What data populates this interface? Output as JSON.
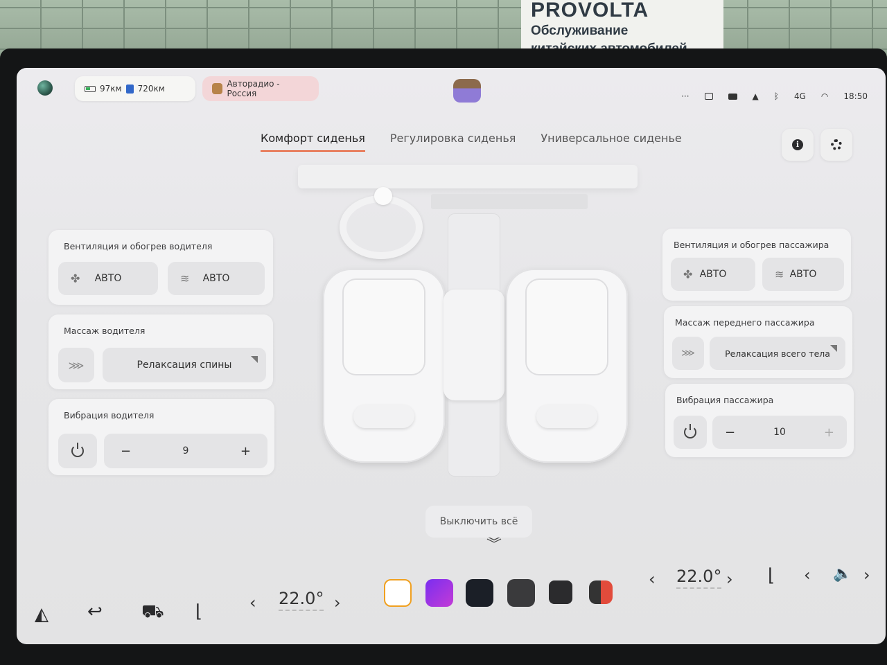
{
  "banner": {
    "brand": "PROVOLTA",
    "line1": "Обслуживание",
    "line2": "китайских автомобилей"
  },
  "status": {
    "range_electric": "97км",
    "range_fuel": "720км",
    "radio": "Авторадио - Россия",
    "time": "18:50",
    "signal": "4G",
    "more": "···"
  },
  "tabs": [
    {
      "label": "Комфорт сиденья",
      "active": true
    },
    {
      "label": "Регулировка сиденья",
      "active": false
    },
    {
      "label": "Универсальное сиденье",
      "active": false
    }
  ],
  "driver": {
    "vent_title": "Вентиляция и обогрев водителя",
    "vent_mode": "АВТО",
    "heat_mode": "АВТО",
    "massage_title": "Массаж водителя",
    "massage_mode": "Релаксация спины",
    "vibration_title": "Вибрация водителя",
    "vibration_value": "9"
  },
  "passenger": {
    "vent_title": "Вентиляция и обогрев пассажира",
    "vent_mode": "АВТО",
    "heat_mode": "АВТО",
    "massage_title": "Массаж переднего пассажира",
    "massage_mode": "Релаксация всего тела",
    "vibration_title": "Вибрация пассажира",
    "vibration_value": "10"
  },
  "controls": {
    "minus": "−",
    "plus": "+",
    "off_all": "Выключить всё"
  },
  "climate": {
    "left_temp": "22.0°",
    "right_temp": "22.0°"
  },
  "colors": {
    "accent": "#e8633a",
    "card": "#f3f3f4",
    "control": "#e4e4e6"
  }
}
